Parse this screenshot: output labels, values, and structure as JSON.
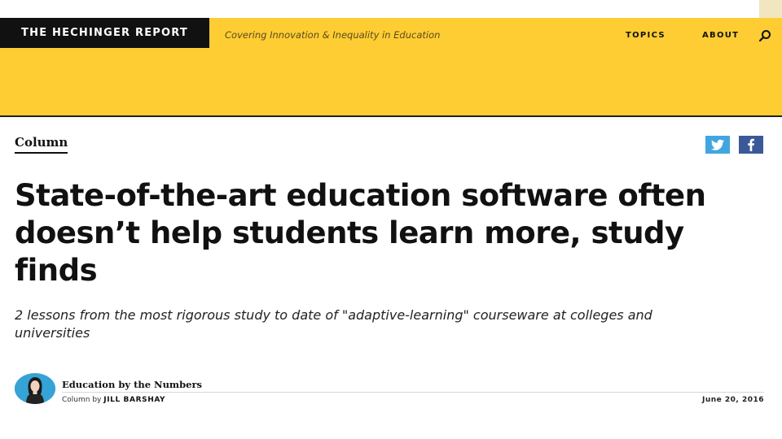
{
  "header": {
    "brand": "THE HECHINGER REPORT",
    "tagline": "Covering Innovation & Inequality in Education",
    "nav": [
      {
        "label": "TOPICS"
      },
      {
        "label": "ABOUT"
      }
    ],
    "search_icon": "search-icon",
    "background_color": "#fdcd33"
  },
  "article": {
    "section_label": "Column",
    "share": [
      {
        "network": "twitter",
        "icon": "twitter-icon",
        "color": "#41a6e0"
      },
      {
        "network": "facebook",
        "icon": "facebook-icon",
        "color": "#3b5998"
      }
    ],
    "title": "State-of-the-art education software often doesn’t help students learn more, study finds",
    "subtitle": "2 lessons from the most rigorous study to date of \"adaptive-learning\" courseware at colleges and universities",
    "byline": {
      "column_name": "Education by the Numbers",
      "prefix": "Column by",
      "author": "JILL BARSHAY",
      "date": "June 20, 2016",
      "avatar_icon": "author-avatar"
    }
  }
}
